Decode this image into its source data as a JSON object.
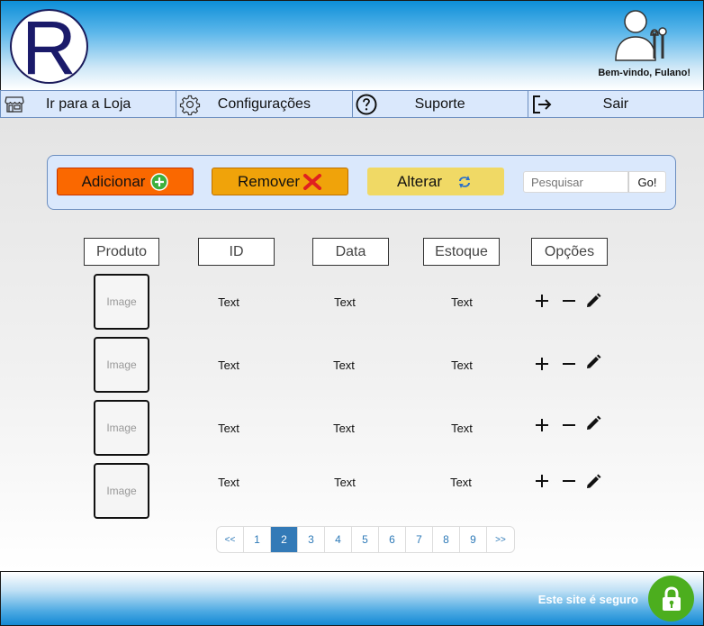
{
  "header": {
    "logo_letter": "R",
    "welcome": "Bem-vindo, Fulano!"
  },
  "nav": {
    "items": [
      {
        "label": "Ir para a Loja",
        "icon": "store-icon"
      },
      {
        "label": "Configurações",
        "icon": "gear-icon"
      },
      {
        "label": "Suporte",
        "icon": "help-icon"
      },
      {
        "label": "Sair",
        "icon": "logout-icon"
      }
    ]
  },
  "toolbar": {
    "add_label": "Adicionar",
    "remove_label": "Remover",
    "alter_label": "Alterar",
    "search_placeholder": "Pesquisar",
    "go_label": "Go!"
  },
  "table": {
    "columns": [
      "Produto",
      "ID",
      "Data",
      "Estoque",
      "Opções"
    ],
    "rows": [
      {
        "image": "Image",
        "id": "Text",
        "data": "Text",
        "estoque": "Text"
      },
      {
        "image": "Image",
        "id": "Text",
        "data": "Text",
        "estoque": "Text"
      },
      {
        "image": "Image",
        "id": "Text",
        "data": "Text",
        "estoque": "Text"
      },
      {
        "image": "Image",
        "id": "Text",
        "data": "Text",
        "estoque": "Text"
      }
    ]
  },
  "pagination": {
    "first": "<<",
    "pages": [
      "1",
      "2",
      "3",
      "4",
      "5",
      "6",
      "7",
      "8",
      "9"
    ],
    "current": "2",
    "last": ">>"
  },
  "footer": {
    "secure_text": "Este site é seguro"
  },
  "colors": {
    "add": "#fa6800",
    "remove": "#f0a30a",
    "alter": "#f0d965",
    "nav_bg": "#dae8fc",
    "secure_green": "#4cae1e",
    "page_active": "#337ab7"
  }
}
